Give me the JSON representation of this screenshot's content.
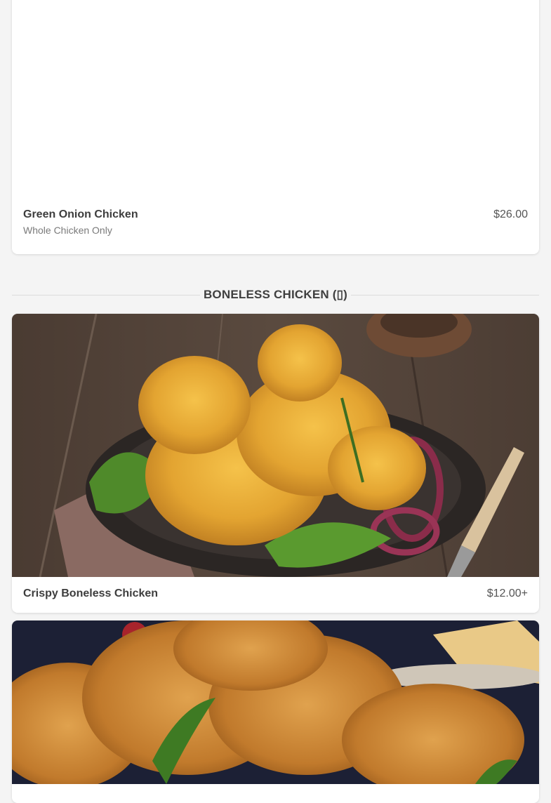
{
  "items": [
    {
      "name": "Green Onion Chicken",
      "subtitle": "Whole Chicken Only",
      "price": "$26.00"
    },
    {
      "name": "Crispy Boneless Chicken",
      "price": "$12.00+"
    }
  ],
  "sections": [
    {
      "title": "BONELESS CHICKEN (▯)"
    }
  ],
  "colors": {
    "page_background": "#f4f4f4",
    "card_background": "#ffffff",
    "divider": "#dcdcdc"
  }
}
